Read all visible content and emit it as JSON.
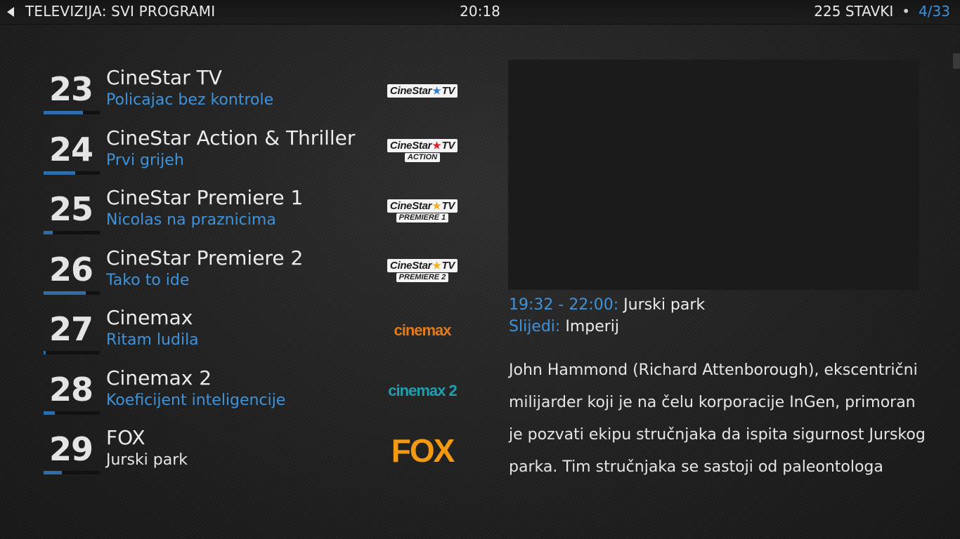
{
  "header": {
    "title": "TELEVIZIJA: SVI PROGRAMI",
    "clock": "20:18",
    "items_count": "225 STAVKI",
    "separator": "•",
    "page": "4/33"
  },
  "channels": [
    {
      "number": "23",
      "name": "CineStar TV",
      "program": "Policajac bez kontrole",
      "progress": 0.7,
      "logo": {
        "label": "CineStar",
        "suffix": "TV",
        "star_color": "#2d7fd2",
        "sub": ""
      }
    },
    {
      "number": "24",
      "name": "CineStar Action & Thriller",
      "program": "Prvi grijeh",
      "progress": 0.56,
      "logo": {
        "label": "CineStar",
        "suffix": "TV",
        "star_color": "#e0202a",
        "sub": "ACTION"
      }
    },
    {
      "number": "25",
      "name": "CineStar Premiere 1",
      "program": "Nicolas na praznicima",
      "progress": 0.16,
      "logo": {
        "label": "CineStar",
        "suffix": "TV",
        "star_color": "#f2b01e",
        "sub": "PREMIERE 1"
      }
    },
    {
      "number": "26",
      "name": "CineStar Premiere 2",
      "program": "Tako to ide",
      "progress": 0.75,
      "logo": {
        "label": "CineStar",
        "suffix": "TV",
        "star_color": "#f2b01e",
        "sub": "PREMIERE 2"
      }
    },
    {
      "number": "27",
      "name": "Cinemax",
      "program": "Ritam ludila",
      "progress": 0.04,
      "logo": {
        "label": "cinemax",
        "color": "#e07a1c"
      }
    },
    {
      "number": "28",
      "name": "Cinemax 2",
      "program": "Koeficijent inteligencije",
      "progress": 0.2,
      "logo": {
        "label": "cinemax 2",
        "color": "#1f9fb0"
      }
    },
    {
      "number": "29",
      "name": "FOX",
      "program": "Jurski park",
      "progress": 0.32,
      "logo": {
        "label": "FOX",
        "color": "#f39a12"
      }
    }
  ],
  "info": {
    "time_range": "19:32 - 22:00:",
    "now_title": "Jurski park",
    "next_label": "Slijedi:",
    "next_title": "Imperij",
    "description_lines": [
      "John Hammond (Richard Attenborough), ekscentrični",
      "milijarder koji je na čelu korporacije InGen, primoran",
      "je pozvati ekipu stručnjaka da ispita sigurnost Jurskog",
      "parka. Tim stručnjaka se sastoji od paleontologa"
    ]
  },
  "colors": {
    "accent": "#3d93dc",
    "progress": "#2f6eaa"
  },
  "icons": {
    "back": "back-arrow-icon"
  }
}
